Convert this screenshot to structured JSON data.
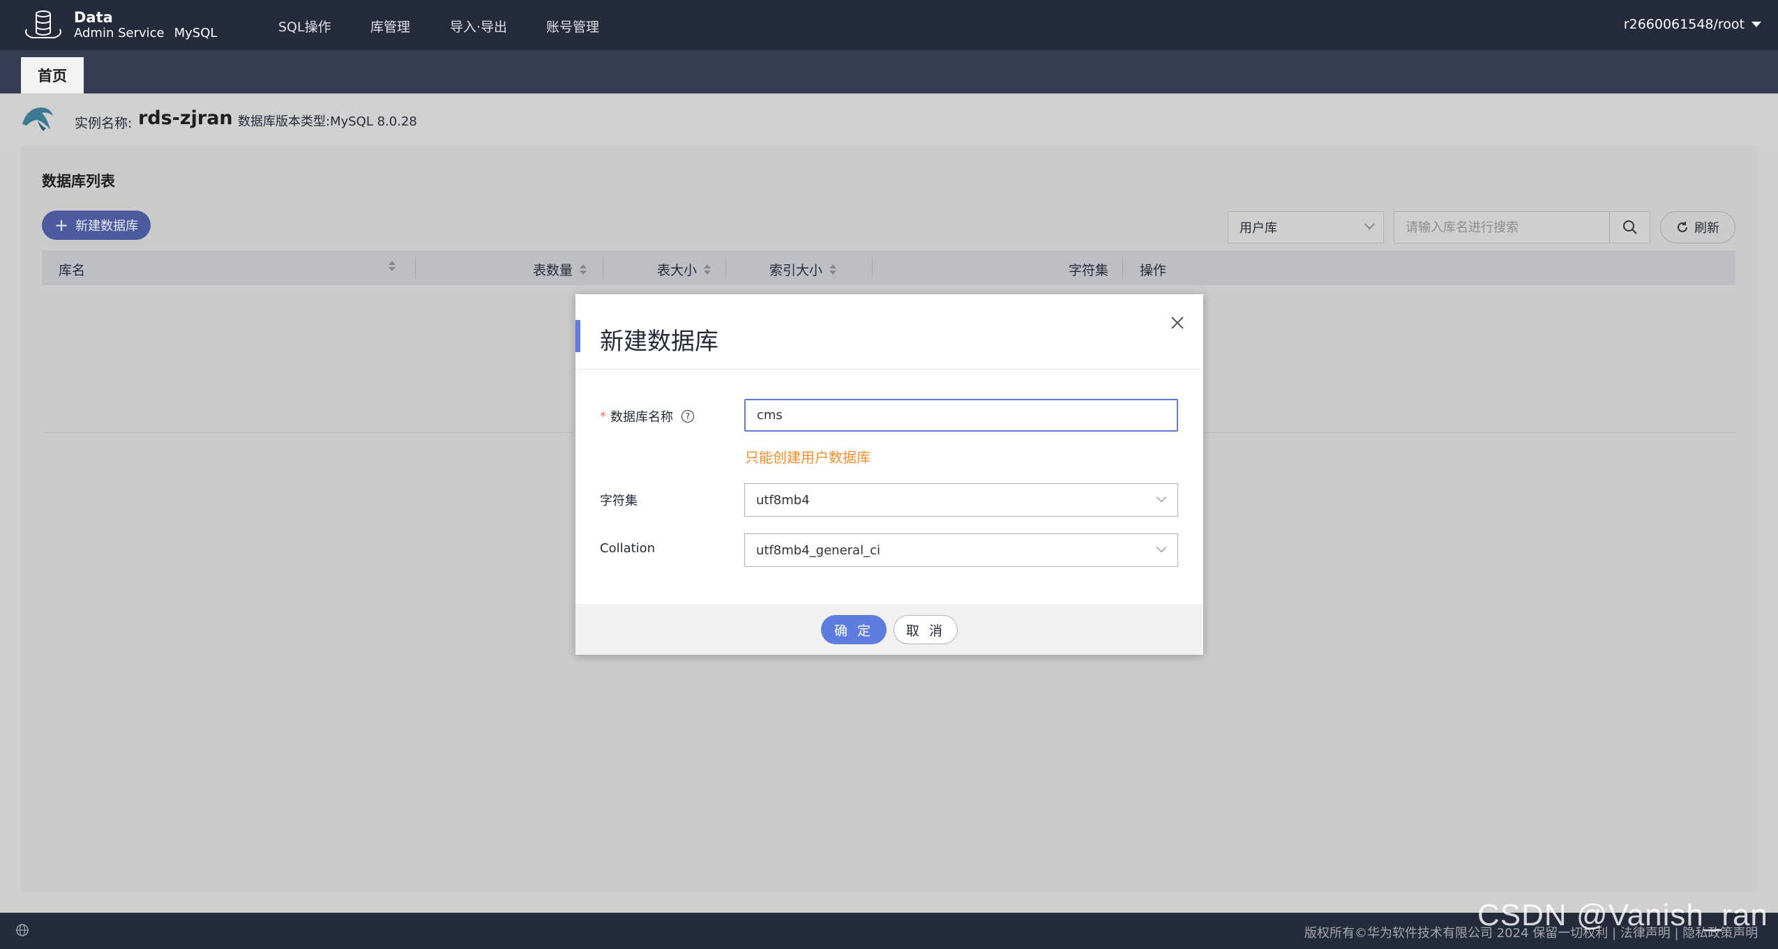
{
  "header": {
    "brand_line1": "Data",
    "brand_line2": "Admin Service",
    "brand_product": "MySQL",
    "nav": [
      "SQL操作",
      "库管理",
      "导入·导出",
      "账号管理"
    ],
    "user": "r2660061548/root"
  },
  "tabs": {
    "home": "首页"
  },
  "instance": {
    "name_label": "实例名称:",
    "name": "rds-zjran",
    "version_label": "数据库版本类型:MySQL 8.0.28"
  },
  "panel": {
    "title": "数据库列表",
    "new_db_button": "新建数据库",
    "db_type_select": "用户库",
    "search_placeholder": "请输入库名进行搜索",
    "refresh_button": "刷新",
    "columns": [
      "库名",
      "表数量",
      "表大小",
      "索引大小",
      "字符集",
      "操作"
    ]
  },
  "dialog": {
    "title": "新建数据库",
    "name_label": "数据库名称",
    "name_value": "cms",
    "warning": "只能创建用户数据库",
    "charset_label": "字符集",
    "charset_value": "utf8mb4",
    "collation_label": "Collation",
    "collation_value": "utf8mb4_general_ci",
    "ok_button": "确 定",
    "cancel_button": "取 消"
  },
  "footer": {
    "copyright": "版权所有©华为软件技术有限公司 2024 保留一切权利 | 法律声明 | 隐私政策声明"
  },
  "watermark": "CSDN @Vanish_ran",
  "colors": {
    "topbar": "#252b3a",
    "accent": "#5e7ce0",
    "warning": "#fa8c26",
    "required": "#f66f6a"
  }
}
